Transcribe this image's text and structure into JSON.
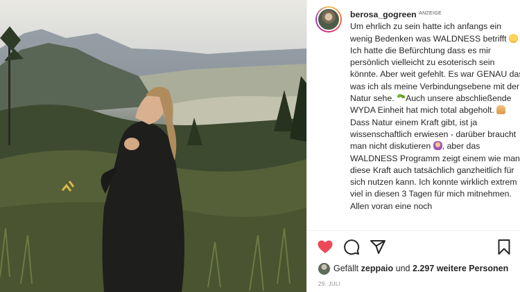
{
  "post": {
    "username": "berosa_gogreen",
    "ad_label": "ANZEIGE",
    "caption": {
      "p1": "Um ehrlich zu sein hatte ich anfangs ein wenig Bedenken was WALDNESS betrifft",
      "p2": "Ich hatte die Befürchtung dass es mir persönlich vielleicht zu esoterisch sein könnte. Aber weit gefehlt. Es war GENAU das was ich als meine Verbindungsebene mit der Natur sehe.",
      "p3": "Auch unsere abschließende WYDA Einheit hat mich total abgeholt.",
      "p4": "Dass Natur einem Kraft gibt, ist ja wissenschaftlich erwiesen - darüber braucht man nicht diskutieren",
      "p5": ", aber das WALDNESS Programm zeigt einem wie man diese Kraft auch tatsächlich ganzheitlich für sich nutzen kann. Ich konnte wirklich extrem viel in diesen 3 Tagen für mich mitnehmen. Allen voran eine noch"
    },
    "emojis": [
      "grinning-sweat",
      "seedling",
      "folded-hands",
      "person-shrugging"
    ],
    "likes": {
      "prefix": "Gefällt",
      "user": "zeppaio",
      "middle": "und",
      "count": "2.297 weitere Personen"
    },
    "date": "29. JULI",
    "like_color": "#ed4956"
  },
  "icons": {
    "like": "heart-icon",
    "comment": "comment-icon",
    "share": "paper-plane-icon",
    "save": "bookmark-icon"
  }
}
